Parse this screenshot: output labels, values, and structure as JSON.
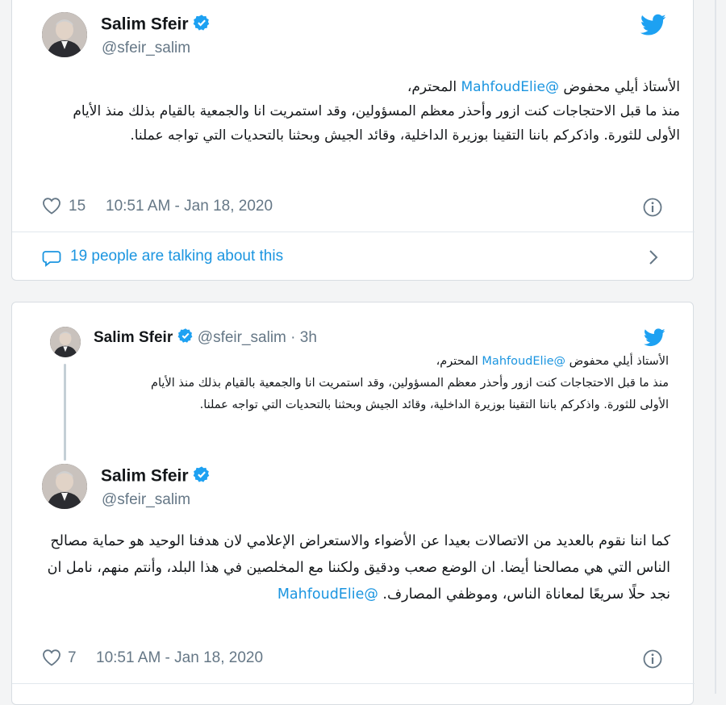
{
  "tweet1": {
    "name": "Salim Sfeir",
    "handle": "@sfeir_salim",
    "text_line1_prefix": "الأستاذ أيلي محفوض ",
    "text_mention": "@MahfoudElie",
    "text_line1_suffix": " المحترم،",
    "text_rest": "منذ ما قبل الاحتجاجات كنت ازور وأحذر معظم المسؤولين، وقد استمريت انا والجمعية بالقيام بذلك منذ الأيام الأولى للثورة.  واذكركم باننا التقينا بوزيرة الداخلية، وقائد الجيش وبحثنا بالتحديات التي تواجه عملنا.",
    "likes": "15",
    "timestamp": "10:51 AM - Jan 18, 2020",
    "talking": "19 people are talking about this"
  },
  "tweet2": {
    "quoted": {
      "name": "Salim Sfeir",
      "handle": "@sfeir_salim",
      "age": "· 3h",
      "text_line1_prefix": "الأستاذ أيلي محفوض ",
      "text_mention": "@MahfoudElie",
      "text_line1_suffix": " المحترم،",
      "text_rest": "منذ ما قبل الاحتجاجات كنت ازور وأحذر معظم المسؤولين، وقد استمريت انا والجمعية بالقيام بذلك منذ الأيام الأولى للثورة.  واذكركم باننا التقينا بوزيرة الداخلية، وقائد الجيش وبحثنا بالتحديات التي تواجه عملنا."
    },
    "name": "Salim Sfeir",
    "handle": "@sfeir_salim",
    "text_body": "كما اننا نقوم بالعديد من الاتصالات بعيدا عن الأضواء والاستعراض الإعلامي لان هدفنا الوحيد هو حماية مصالح الناس التي هي مصالحنا أيضا. ان الوضع صعب ودقيق ولكننا مع المخلصين في هذا البلد، وأنتم منهم، نامل ان نجد حلًا سريعًا لمعاناة الناس، وموظفي المصارف. ",
    "text_mention": "@MahfoudElie",
    "likes": "7",
    "timestamp": "10:51 AM - Jan 18, 2020"
  },
  "colors": {
    "accent": "#1da1f2",
    "link": "#1b95e0",
    "muted": "#657786"
  },
  "icons": [
    "twitter-bird-icon",
    "verified-badge-icon",
    "heart-icon",
    "info-icon",
    "comment-bubble-icon",
    "chevron-right-icon"
  ]
}
